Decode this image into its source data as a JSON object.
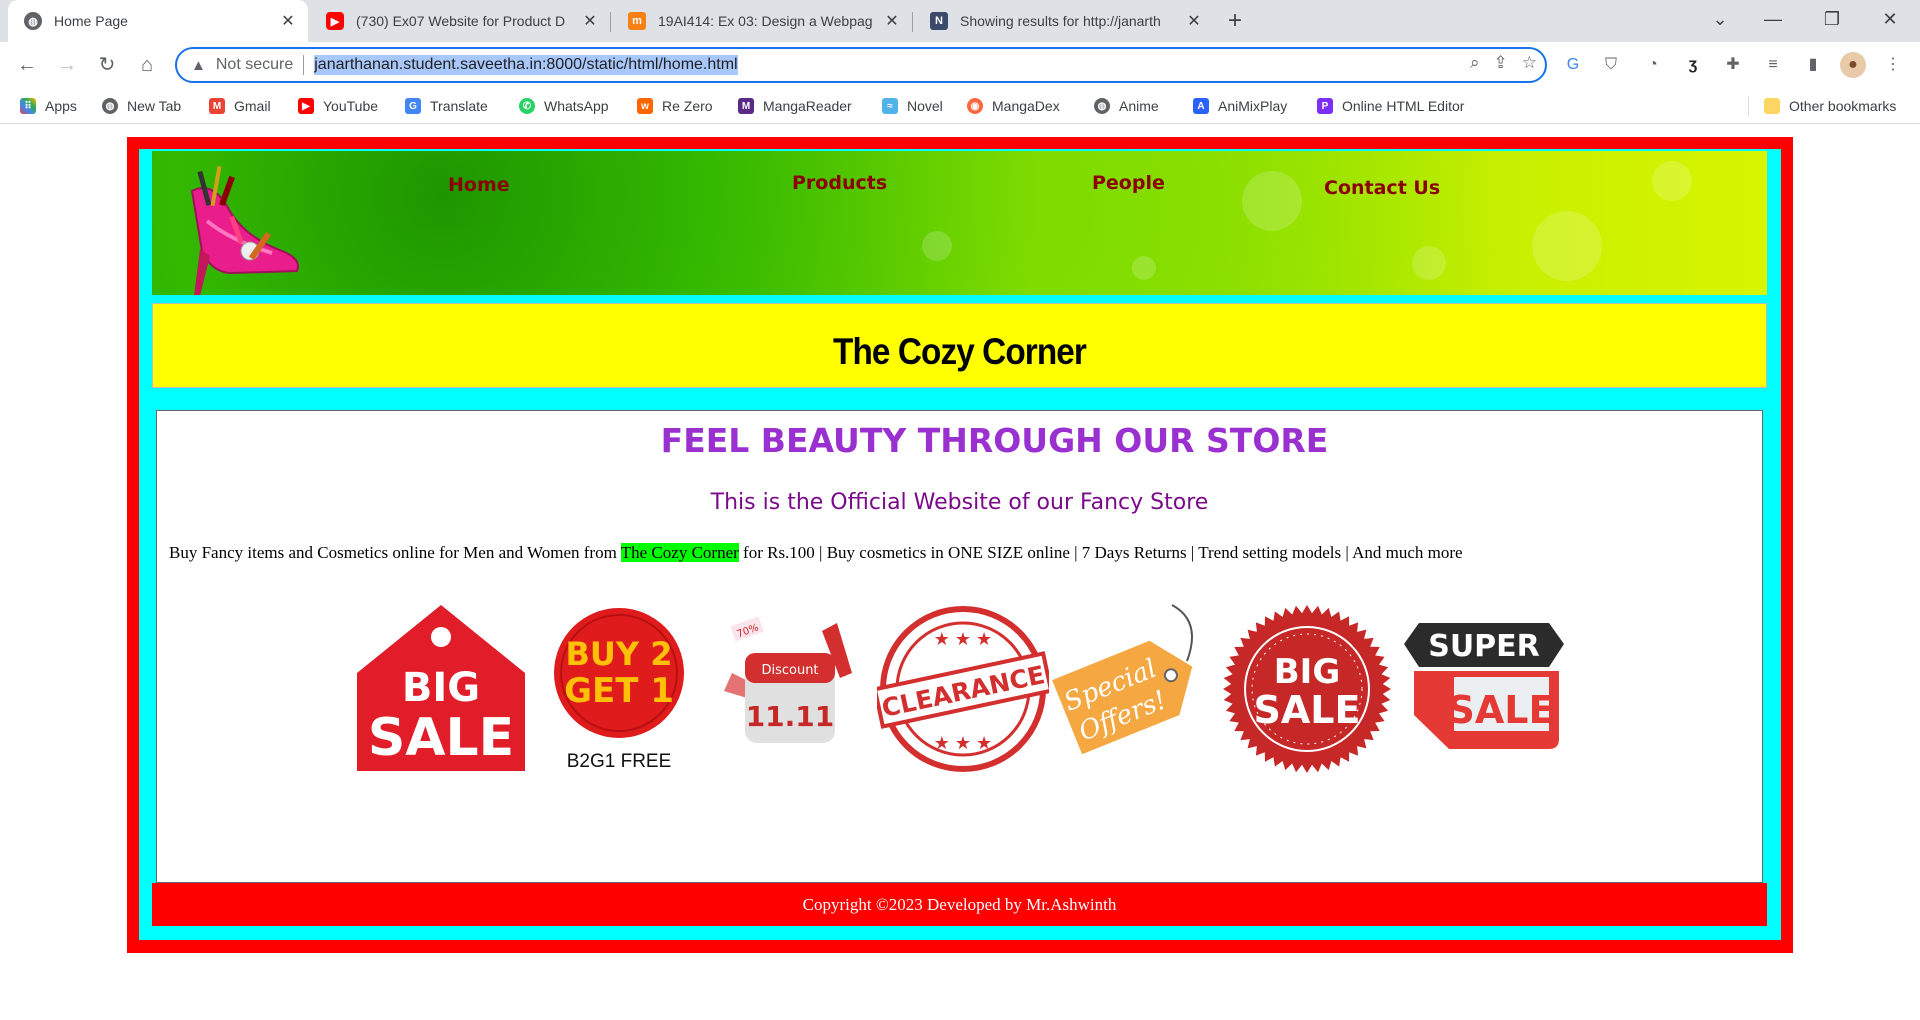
{
  "browser": {
    "tabs": [
      {
        "title": "Home Page",
        "active": true,
        "favicon": "globe-icon"
      },
      {
        "title": "(730) Ex07 Website for Product D",
        "active": false,
        "favicon": "youtube-icon"
      },
      {
        "title": "19AI414: Ex 03: Design a Webpag",
        "active": false,
        "favicon": "moodle-icon"
      },
      {
        "title": "Showing results for http://janarth",
        "active": false,
        "favicon": "validator-icon"
      }
    ],
    "address": {
      "security_label": "Not secure",
      "url": "janarthanan.student.saveetha.in:8000/static/html/home.html"
    },
    "bookmarks": [
      "Apps",
      "New Tab",
      "Gmail",
      "YouTube",
      "Translate",
      "WhatsApp",
      "Re Zero",
      "MangaReader",
      "Novel",
      "MangaDex",
      "Anime",
      "AniMixPlay",
      "Online HTML Editor"
    ],
    "other_bookmarks": "Other bookmarks"
  },
  "page": {
    "nav": [
      "Home",
      "Products",
      "People",
      "Contact Us"
    ],
    "site_title": "The Cozy Corner",
    "headline": "FEEL BEAUTY THROUGH OUR STORE",
    "subline": "This is the Official Website of our Fancy Store",
    "description_pre": "Buy Fancy items and Cosmetics online for Men and Women from ",
    "description_highlight": "The Cozy Corner",
    "description_post": " for Rs.100 | Buy cosmetics in ONE SIZE online | 7 Days Returns | Trend setting models | And much more",
    "badges": {
      "big_sale_1": [
        "BIG",
        "SALE"
      ],
      "b2g1": [
        "BUY 2",
        "GET 1",
        "B2G1 FREE"
      ],
      "discount": [
        "70%",
        "Discount",
        "11.11"
      ],
      "clearance": "CLEARANCE",
      "special": [
        "Special",
        "Offers!"
      ],
      "big_sale_2": [
        "BIG",
        "SALE"
      ],
      "super_sale": [
        "SUPER",
        "SALE"
      ]
    },
    "footer": "Copyright ©2023 Developed by Mr.Ashwinth"
  },
  "colors": {
    "outer_border": "#ff0000",
    "inner_border": "#00ffff",
    "title_bg": "#ffff00",
    "headline": "#9b30d0",
    "subline": "#7a0a8a",
    "nav_link": "#8b0000",
    "highlight": "#00ff00"
  }
}
